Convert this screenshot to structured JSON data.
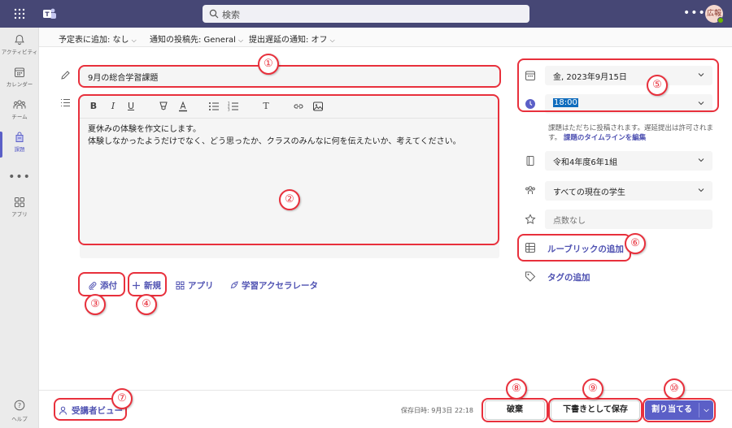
{
  "topbar": {
    "search_placeholder": "検索",
    "more": "•••",
    "avatar_initials": "広報"
  },
  "rail": {
    "items": [
      {
        "label": "アクティビティ"
      },
      {
        "label": "カレンダー"
      },
      {
        "label": "チーム"
      },
      {
        "label": "課題"
      },
      {
        "label": "アプリ"
      }
    ],
    "more": "•••",
    "help": "ヘルプ"
  },
  "options": {
    "calendar": "予定表に追加: なし",
    "post_to": "通知の投稿先: General",
    "late": "提出遅延の通知: オフ"
  },
  "assignment": {
    "title": "9月の総合学習課題",
    "instructions_line1": "夏休みの体験を作文にします。",
    "instructions_line2": "体験しなかったようだけでなく、どう思ったか、クラスのみんなに何を伝えたいか、考えてください。"
  },
  "toolbar": {
    "bold": "B",
    "italic": "I",
    "underline": "U",
    "clear_format": "T"
  },
  "attach": {
    "attach_label": "添付",
    "new_label": "新規",
    "apps_label": "アプリ",
    "accelerator_label": "学習アクセラレータ"
  },
  "right_panel": {
    "due_date": "金, 2023年9月15日",
    "due_time": "18:00",
    "note_text": "課題はただちに投稿されます。遅延提出は許可されます。",
    "note_link": "課題のタイムラインを編集",
    "class_name": "令和4年度6年1組",
    "students": "すべての現在の学生",
    "points": "点数なし",
    "rubric": "ルーブリックの追加",
    "tags": "タグの追加"
  },
  "footer": {
    "learner_view": "受講者ビュー",
    "saved": "保存日時: 9月3日 22:18",
    "discard": "破棄",
    "save_draft": "下書きとして保存",
    "assign": "割り当てる"
  },
  "annotations": [
    "①",
    "②",
    "③",
    "④",
    "⑤",
    "⑥",
    "⑦",
    "⑧",
    "⑨",
    "⑩"
  ],
  "colors": {
    "topbar": "#464775",
    "accent": "#5b5fc7",
    "annotation": "#e8303c"
  }
}
